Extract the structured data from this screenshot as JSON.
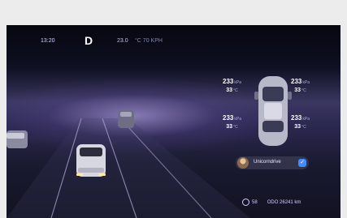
{
  "status_bar": {
    "time": "13:20",
    "gear": "D",
    "temperature": "23.0",
    "temperature_suffix": "°C  70 KPH"
  },
  "tires": {
    "front_left": {
      "pressure": "233",
      "unit": "kPa",
      "temp": "33",
      "temp_unit": "°C"
    },
    "front_right": {
      "pressure": "233",
      "unit": "kPa",
      "temp": "33",
      "temp_unit": "°C"
    },
    "rear_left": {
      "pressure": "233",
      "unit": "kPa",
      "temp": "33",
      "temp_unit": "°C"
    },
    "rear_right": {
      "pressure": "233",
      "unit": "kPa",
      "temp": "33",
      "temp_unit": "°C"
    }
  },
  "driver": {
    "name": "Unicorndrive",
    "badge_icon": "check-icon",
    "avatar_icon": "user-avatar"
  },
  "bottom_bar": {
    "range_value": "58",
    "odometer": "ODO 26241 km"
  },
  "icons": {
    "car": "car-top-view-icon",
    "range": "clock-icon"
  },
  "colors": {
    "accent": "#3f8cff",
    "text": "#cfd2ff"
  }
}
